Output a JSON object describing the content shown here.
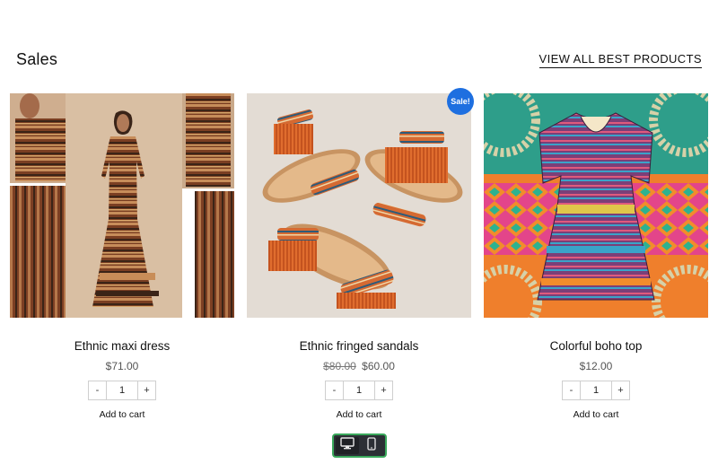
{
  "section": {
    "title": "Sales",
    "view_all_label": "VIEW ALL BEST PRODUCTS"
  },
  "products": [
    {
      "name": "Ethnic maxi dress",
      "old_price": "",
      "price": "$71.00",
      "quantity": "1",
      "add_to_cart": "Add to cart",
      "badge": ""
    },
    {
      "name": "Ethnic fringed sandals",
      "old_price": "$80.00",
      "price": "$60.00",
      "quantity": "1",
      "add_to_cart": "Add to cart",
      "badge": "Sale!"
    },
    {
      "name": "Colorful boho top",
      "old_price": "",
      "price": "$12.00",
      "quantity": "1",
      "add_to_cart": "Add to cart",
      "badge": ""
    }
  ],
  "quantity_controls": {
    "minus": "-",
    "plus": "+"
  },
  "device_toggle": {
    "options": [
      {
        "icon": "desktop-icon",
        "active": true
      },
      {
        "icon": "mobile-icon",
        "active": false
      }
    ]
  },
  "colors": {
    "sale_badge": "#1e6fe0",
    "toggle_border": "#3aa85b",
    "toggle_bg": "#2c2f35"
  }
}
